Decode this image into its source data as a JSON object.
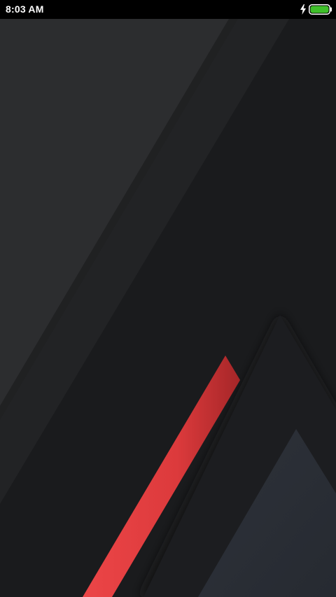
{
  "status_bar": {
    "time": "8:03 AM",
    "icons": [
      "charging-bolt-icon",
      "battery-icon"
    ],
    "battery_color": "#3fbf2a"
  },
  "wallpaper": {
    "description_colors": {
      "background": "#1a1b1d",
      "accent_stripe": "#e0393b",
      "panel_light": "#2a2b2d",
      "triangle_slate": "#2a2e35"
    }
  }
}
